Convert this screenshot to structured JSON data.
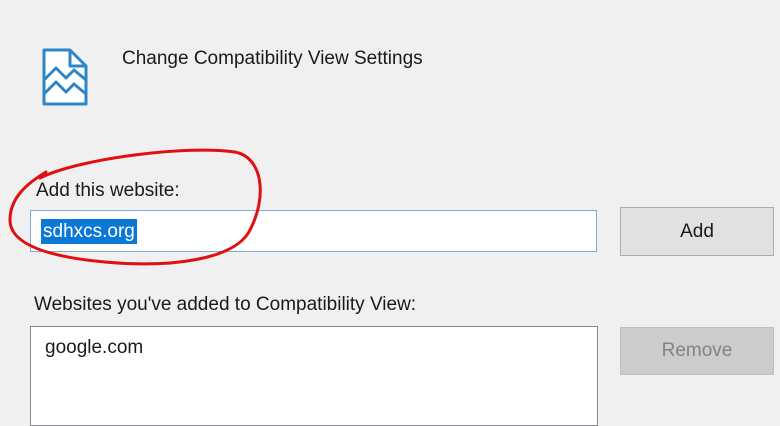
{
  "dialog": {
    "title": "Change Compatibility View Settings",
    "icon": "compatibility-view-icon"
  },
  "add_section": {
    "label": "Add this website:",
    "input_value": "sdhxcs.org",
    "add_button_label": "Add"
  },
  "list_section": {
    "label": "Websites you've added to Compatibility View:",
    "items": [
      "google.com"
    ],
    "remove_button_label": "Remove",
    "remove_enabled": false
  },
  "colors": {
    "selection": "#0a78d7",
    "input_border": "#7fa9d6",
    "annotation": "#e01010"
  }
}
